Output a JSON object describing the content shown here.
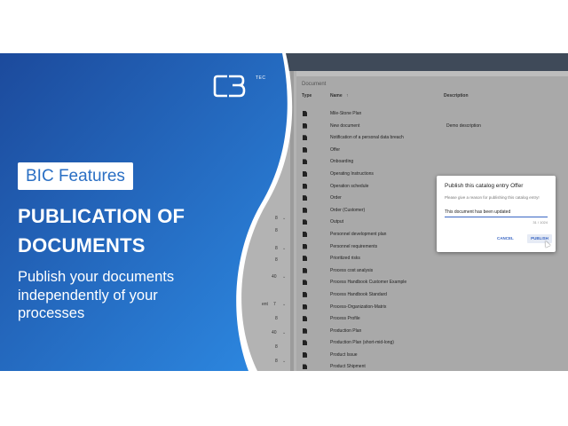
{
  "overlay": {
    "logo_tag": "TEC",
    "badge": "BIC Features",
    "headline_lines": [
      "PUBLICATION OF",
      "DOCUMENTS"
    ],
    "sub_lines": [
      "Publish your documents",
      "independently of your",
      "processes"
    ],
    "colors": {
      "blue_dark": "#1e4fa0",
      "blue_light": "#2b86e0",
      "badge_text": "#2a6fc4"
    }
  },
  "app": {
    "panel_title": "Document",
    "columns": {
      "type": "Type",
      "name": "Name",
      "sort_icon": "arrow-up-icon",
      "description": "Description"
    },
    "rows": [
      {
        "name": "Mile-Stone Plan",
        "description": ""
      },
      {
        "name": "New document",
        "description": "Demo description"
      },
      {
        "name": "Notification of a personal data breach",
        "description": ""
      },
      {
        "name": "Offer",
        "description": ""
      },
      {
        "name": "Onboarding",
        "description": ""
      },
      {
        "name": "Operating Instructions",
        "description": ""
      },
      {
        "name": "Operation schedule",
        "description": ""
      },
      {
        "name": "Order",
        "description": ""
      },
      {
        "name": "Order (Customer)",
        "description": ""
      },
      {
        "name": "Output",
        "description": ""
      },
      {
        "name": "Personnel development plan",
        "description": ""
      },
      {
        "name": "Personnel requirements",
        "description": ""
      },
      {
        "name": "Prioritized risks",
        "description": ""
      },
      {
        "name": "Process cost analysis",
        "description": ""
      },
      {
        "name": "Process Handbook Customer Example",
        "description": ""
      },
      {
        "name": "Process Handbook Standard",
        "description": ""
      },
      {
        "name": "Process-Organization-Matrix",
        "description": ""
      },
      {
        "name": "Process Profile",
        "description": ""
      },
      {
        "name": "Production Plan",
        "description": ""
      },
      {
        "name": "Production Plan (short-mid-long)",
        "description": ""
      },
      {
        "name": "Product Issue",
        "description": ""
      },
      {
        "name": "Product Shipment",
        "description": ""
      }
    ],
    "side_numbers": [
      "8",
      "8",
      "8",
      "8",
      "40",
      "7",
      "8",
      "40",
      "8",
      "8"
    ],
    "side_label": "ent"
  },
  "dialog": {
    "title": "Publish this catalog entry Offer",
    "subtitle": "Please give a reason for publishing this catalog entry!",
    "input_value": "This document has been updated",
    "counter": "31 / 1024",
    "cancel_label": "CANCEL",
    "publish_label": "PUBLISH"
  }
}
